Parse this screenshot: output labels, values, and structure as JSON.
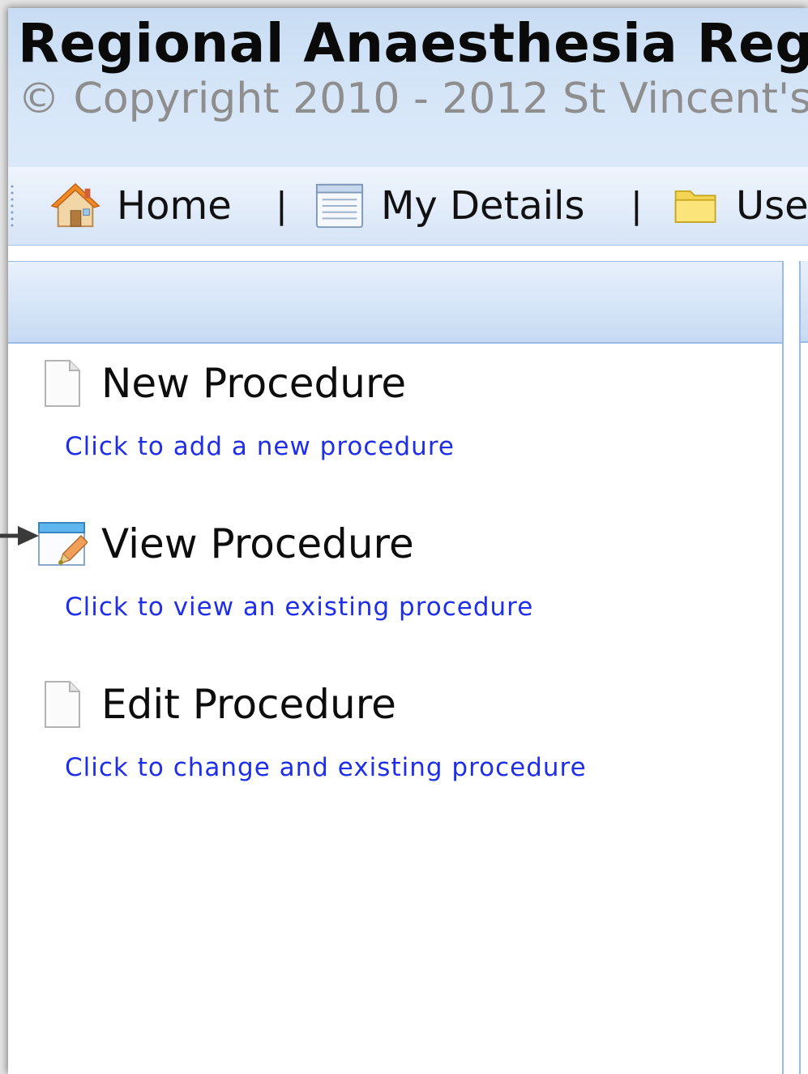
{
  "header": {
    "title": "Regional Anaesthesia Reg",
    "copyright": "© Copyright 2010 - 2012 St Vincent's"
  },
  "toolbar": {
    "items": [
      {
        "label": "Home",
        "icon": "home-icon"
      },
      {
        "label": "My Details",
        "icon": "details-icon"
      },
      {
        "label": "Use",
        "icon": "folder-icon"
      }
    ],
    "separator": "|"
  },
  "procedures": [
    {
      "title": "New Procedure",
      "link": "Click to add a new procedure",
      "icon": "blank-document-icon"
    },
    {
      "title": "View Procedure",
      "link": "Click to view an existing procedure",
      "icon": "window-edit-icon"
    },
    {
      "title": "Edit Procedure",
      "link": "Click to change and existing procedure",
      "icon": "blank-document-icon"
    }
  ],
  "colors": {
    "link": "#1f2ee8",
    "header_bg": "#d6e6f8",
    "border": "#99bbe8",
    "copyright": "#8e8e8e"
  }
}
